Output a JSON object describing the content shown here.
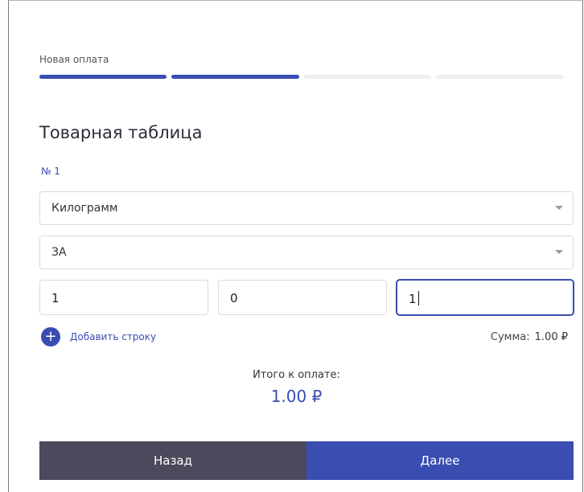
{
  "header": {
    "step_title": "Новая оплата",
    "progress": {
      "total_steps": 4,
      "completed_steps": 2
    }
  },
  "form": {
    "heading": "Товарная таблица",
    "row_number": "№ 1",
    "unit_select": {
      "value": "Килограмм"
    },
    "item_select": {
      "value": "ЗА"
    },
    "inputs": [
      {
        "value": "1"
      },
      {
        "value": "0"
      },
      {
        "value": "1"
      }
    ],
    "add_row_label": "Добавить строку",
    "add_row_icon": "+",
    "sum": {
      "label": "Сумма:",
      "value": "1.00 ₽"
    }
  },
  "total": {
    "label": "Итого к оплате:",
    "value": "1.00 ₽"
  },
  "footer": {
    "back_label": "Назад",
    "next_label": "Далее"
  },
  "colors": {
    "accent": "#3a4db0",
    "dark_button": "#4a4a5c",
    "progress_inactive": "#efefef"
  }
}
